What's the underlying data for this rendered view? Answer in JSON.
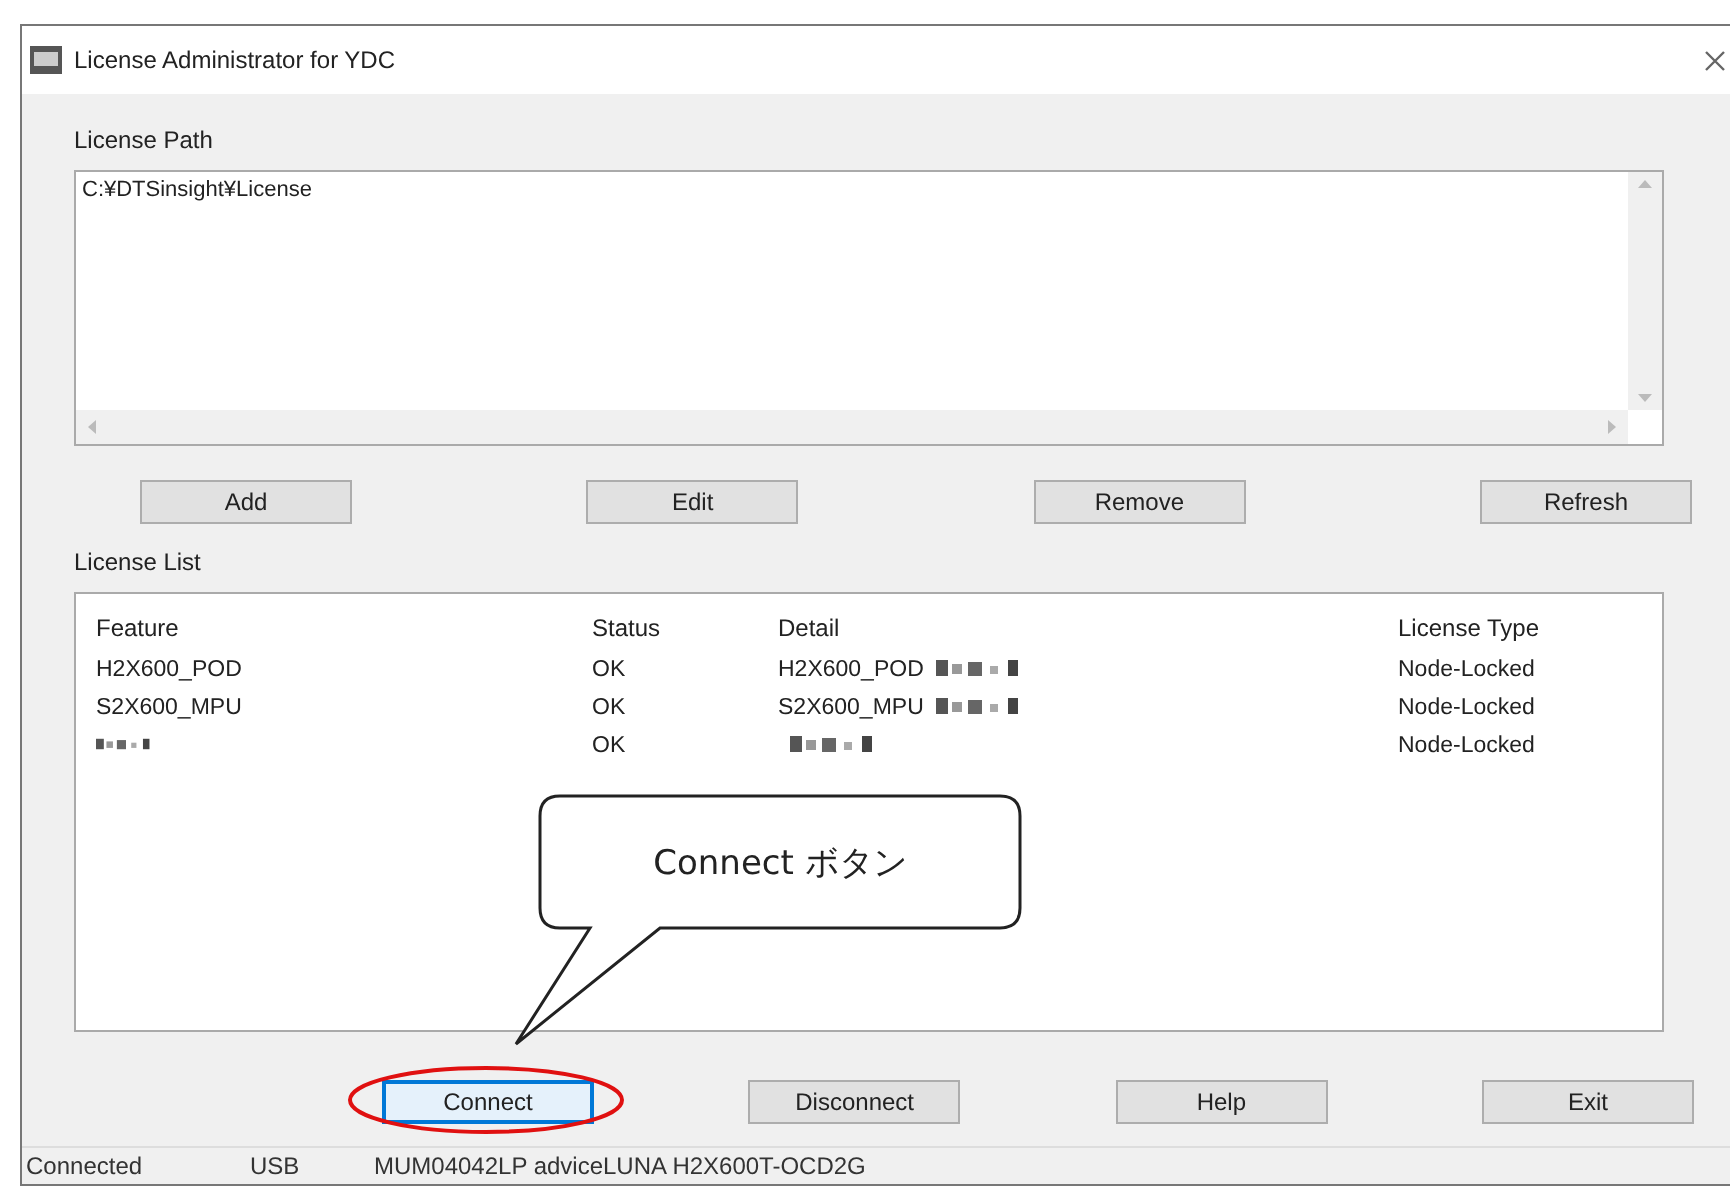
{
  "window": {
    "title": "License Administrator for YDC"
  },
  "license_path": {
    "label": "License Path",
    "value": "C:¥DTSinsight¥License"
  },
  "path_buttons": [
    "Add",
    "Edit",
    "Remove",
    "Refresh"
  ],
  "license_list": {
    "label": "License List",
    "columns": [
      "Feature",
      "Status",
      "Detail",
      "License Type"
    ],
    "rows": [
      {
        "feature": "H2X600_POD",
        "status": "OK",
        "detail": "H2X600_POD",
        "license_type": "Node-Locked"
      },
      {
        "feature": "S2X600_MPU",
        "status": "OK",
        "detail": "S2X600_MPU",
        "license_type": "Node-Locked"
      },
      {
        "status": "OK",
        "license_type": "Node-Locked"
      }
    ]
  },
  "bottom_buttons": [
    {
      "label": "Connect",
      "selected": true
    },
    {
      "label": "Disconnect",
      "selected": false
    },
    {
      "label": "Help",
      "selected": false
    },
    {
      "label": "Exit",
      "selected": false
    }
  ],
  "status_bar": [
    "Connected",
    "USB",
    "MUM04042LP adviceLUNA H2X600T-OCD2G"
  ],
  "callout": {
    "text": "Connect ボタン"
  }
}
